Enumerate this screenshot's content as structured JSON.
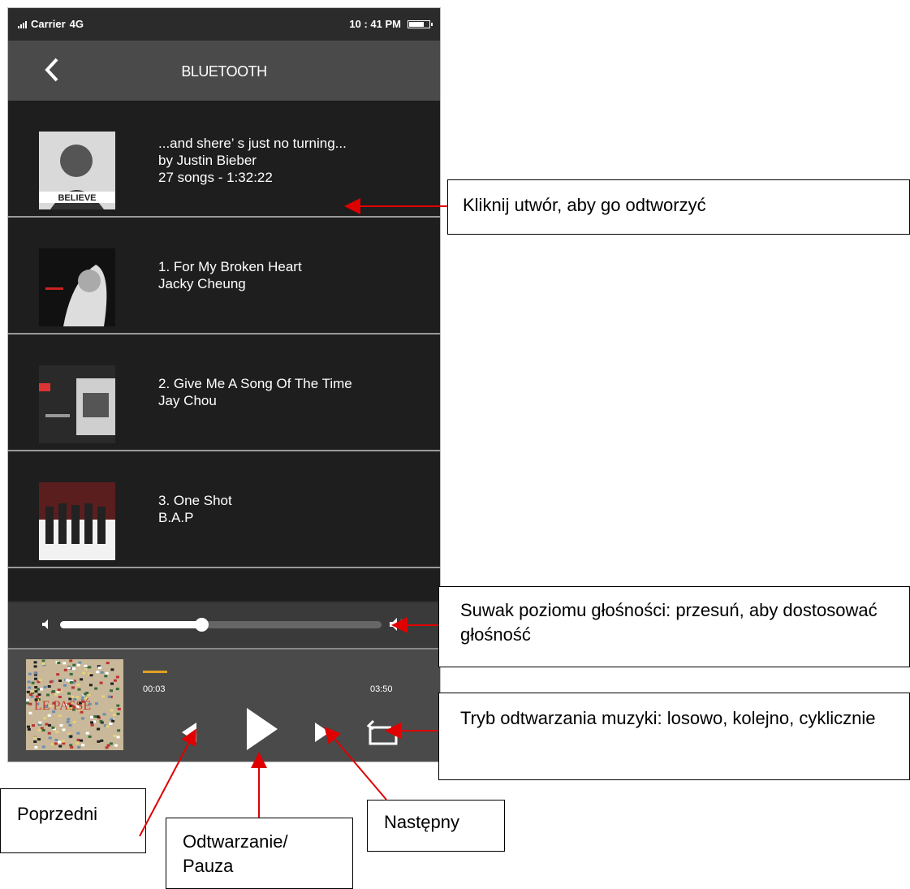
{
  "status_bar": {
    "carrier": "Carrier",
    "network": "4G",
    "time": "10 : 41 PM"
  },
  "nav": {
    "title": "BLUETOOTH",
    "back_icon": "chevron-left-icon"
  },
  "tracks": [
    {
      "title": "...and shere’ s just no turning...",
      "artist": "by Justin Bieber",
      "extra": "27 songs - 1:32:22",
      "cover_text": "BELIEVE"
    },
    {
      "title": "1. For My Broken Heart",
      "artist": "Jacky Cheung"
    },
    {
      "title": "2. Give Me A Song Of The Time",
      "artist": "Jay Chou"
    },
    {
      "title": "3. One Shot",
      "artist": "B.A.P"
    }
  ],
  "volume": {
    "level": 0.44,
    "low_icon": "volume-low-icon",
    "high_icon": "volume-high-icon"
  },
  "player": {
    "current_time": "00:03",
    "total_time": "03:50",
    "progress": 0.013,
    "accent_color": "#e0a020"
  },
  "annotations": {
    "track_tap": "Kliknij utwór, aby go odtworzyć",
    "volume_slider": "Suwak poziomu głośności: przesuń, aby dostosować głośność",
    "play_mode": "Tryb odtwarzania muzyki: losowo, kolejno, cyklicznie",
    "previous": "Poprzedni",
    "play_pause": "Odtwarzanie/ Pauza",
    "next": "Następny"
  }
}
